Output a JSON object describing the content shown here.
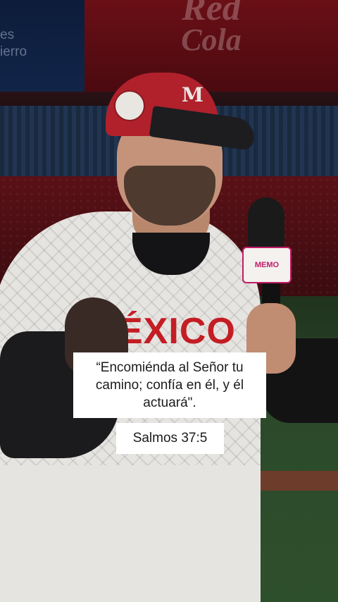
{
  "background": {
    "ad_left_text": "es\nierro",
    "ad_right_line1": "Red",
    "ad_right_line2": "Cola",
    "jersey_text": "ÉXICO",
    "cap_mark": "M",
    "mic_flag_text": "MEMO"
  },
  "caption": {
    "quote": "“Encomiénda al Señor tu camino; confía en él, y él actuará\".",
    "reference": "Salmos 37:5"
  },
  "colors": {
    "jersey_red": "#c41d24",
    "cap_red": "#b0212c",
    "caption_bg": "#ffffff",
    "caption_text": "#1b1b1b"
  }
}
